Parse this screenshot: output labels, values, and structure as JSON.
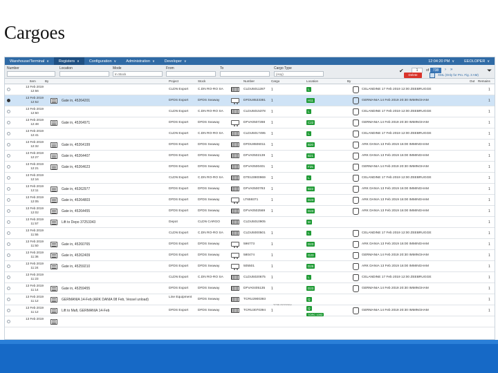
{
  "slide": {
    "title": "Cargoes"
  },
  "menu": {
    "items": [
      {
        "label": "Warehouse/Terminal",
        "active": false
      },
      {
        "label": "Registers",
        "active": true
      },
      {
        "label": "Configuration",
        "active": false
      },
      {
        "label": "Administration",
        "active": false
      },
      {
        "label": "Developer",
        "active": false
      }
    ],
    "time": "12:04:20 PM",
    "user": "EEOLOPER"
  },
  "filters": {
    "number_label": "Number",
    "location_label": "Location",
    "mode_label": "Mode",
    "mode_value": "In Stock",
    "from_label": "From",
    "to_label": "To",
    "cargo_type_label": "Cargo Type",
    "cargo_type_value": "(Any)",
    "page_value": "1",
    "page_of": "of",
    "page_total": "738",
    "delete_label": "Delete",
    "xml_label": "XML (Only for Pro. Fig. 3 AM)"
  },
  "columns": [
    "Item",
    "By",
    "Project",
    "Stock",
    "Number",
    "Cargo",
    "Location",
    "By",
    "Out",
    "Remains"
  ],
  "rows": [
    {
      "date": "13 Feb 2019",
      "time": "12:56",
      "doc": false,
      "subject": "",
      "project": "CLDN Export",
      "stock": "C.DN RO-RO SA",
      "eq": "container",
      "number": "CLDU5011287",
      "cargo": "1",
      "loc": "L",
      "ship": "CELANDINE 17 Feb 2019 12:00 ZEEBRUGGE",
      "remains": "1",
      "selected": false
    },
    {
      "date": "13 Feb 2019",
      "time": "12:52",
      "doc": true,
      "subject": "Gate in, 45264201",
      "project": "DFDS Export",
      "stock": "DFDS Seaway",
      "eq": "truck",
      "number": "DFDU8533381",
      "cargo": "1",
      "loc": "H11",
      "ship": "GERMANIA 14 Feb 2019 20:30 IMMINGHAM",
      "remains": "1",
      "selected": true
    },
    {
      "date": "13 Feb 2019",
      "time": "12:50",
      "doc": false,
      "subject": "",
      "project": "CLDN Export",
      "stock": "C.DN RO-RO SA",
      "eq": "container",
      "number": "CLDU5015378",
      "cargo": "1",
      "loc": "L",
      "ship": "CELANDINE 17 Feb 2019 12:00 ZEEBRUGGE",
      "remains": "1",
      "selected": false
    },
    {
      "date": "13 Feb 2019",
      "time": "12:48",
      "doc": true,
      "subject": "Gate in, 45264971",
      "project": "DFDS Export",
      "stock": "DFDS Seaway",
      "eq": "truck",
      "number": "DFVA0507288",
      "cargo": "1",
      "loc": "C22",
      "ship": "GERMANIA 14 Feb 2019 20:30 IMMINGHAM",
      "remains": "1",
      "selected": false
    },
    {
      "date": "13 Feb 2019",
      "time": "12:41",
      "doc": false,
      "subject": "",
      "project": "CLDN Export",
      "stock": "C.DN RO-RO SA",
      "eq": "container",
      "number": "CLDU5017495",
      "cargo": "1",
      "loc": "L",
      "ship": "CELANDINE 17 Feb 2019 12:00 ZEEBRUGGE",
      "remains": "1",
      "selected": false
    },
    {
      "date": "13 Feb 2019",
      "time": "12:32",
      "doc": true,
      "subject": "Gate in, 45264199",
      "project": "DFDS Export",
      "stock": "DFDS Seaway",
      "eq": "container",
      "number": "DFDU8506011",
      "cargo": "1",
      "loc": "B20",
      "ship": "ARK DANIA 13 Feb 2019 16:00 IMMINGHAM",
      "remains": "1",
      "selected": false
    },
    {
      "date": "13 Feb 2019",
      "time": "12:27",
      "doc": true,
      "subject": "Gate in, 45264407",
      "project": "DFDS Export",
      "stock": "DFDS Seaway",
      "eq": "container",
      "number": "DFVA0502139",
      "cargo": "1",
      "loc": "B21",
      "ship": "ARK DANIA 13 Feb 2019 16:00 IMMINGHAM",
      "remains": "1",
      "selected": false
    },
    {
      "date": "13 Feb 2019",
      "time": "12:21",
      "doc": true,
      "subject": "Gate in, 45264623",
      "project": "DFDS Export",
      "stock": "DFDS Seaway",
      "eq": "container",
      "number": "DFVA0500401",
      "cargo": "1",
      "loc": "F25",
      "ship": "GERMANIA 14 Feb 2019 20:30 IMMINGHAM",
      "remains": "1",
      "selected": false
    },
    {
      "date": "13 Feb 2019",
      "time": "12:16",
      "doc": false,
      "subject": "",
      "project": "CLDN Export",
      "stock": "C.DN RO-RO SA",
      "eq": "container",
      "number": "DTEU3900969",
      "cargo": "1",
      "loc": "L",
      "ship": "CELANDINE 17 Feb 2019 12:00 ZEEBRUGGE",
      "remains": "1",
      "selected": false
    },
    {
      "date": "13 Feb 2019",
      "time": "12:11",
      "doc": true,
      "subject": "Gate in, 45262977",
      "project": "DFDS Export",
      "stock": "DFDS Seaway",
      "eq": "container",
      "number": "DFVA0500783",
      "cargo": "1",
      "loc": "B22",
      "ship": "ARK DANIA 13 Feb 2019 16:00 IMMINGHAM",
      "remains": "1",
      "selected": false
    },
    {
      "date": "13 Feb 2019",
      "time": "12:05",
      "doc": true,
      "subject": "Gate in, 45264803",
      "project": "DFDS Export",
      "stock": "DFDS Seaway",
      "eq": "truck",
      "number": "LT659371",
      "cargo": "1",
      "loc": "D23",
      "ship": "ARK DANIA 13 Feb 2019 16:00 IMMINGHAM",
      "remains": "1",
      "selected": false
    },
    {
      "date": "13 Feb 2019",
      "time": "12:02",
      "doc": true,
      "subject": "Gate in, 45264455",
      "project": "DFDS Export",
      "stock": "DFDS Seaway",
      "eq": "container",
      "number": "DFVA0502569",
      "cargo": "1",
      "loc": "D23",
      "ship": "ARK DANIA 13 Feb 2019 16:00 IMMINGHAM",
      "remains": "1",
      "selected": false
    },
    {
      "date": "13 Feb 2019",
      "time": "11:57",
      "doc": true,
      "subject": "Lift to Depo 37253343",
      "project": "Depot",
      "stock": "CLDN CARGO",
      "eq": "container",
      "number": "CLDU5010905",
      "cargo": "",
      "loc": "M",
      "ship": "",
      "remains": "1",
      "selected": false
    },
    {
      "date": "13 Feb 2019",
      "time": "11:55",
      "doc": false,
      "subject": "",
      "project": "CLDN Export",
      "stock": "C.DN RO-RO SA",
      "eq": "container",
      "number": "CLDU5000501",
      "cargo": "1",
      "loc": "L",
      "ship": "CELANDINE 17 Feb 2019 12:00 ZEEBRUGGE",
      "remains": "1",
      "selected": false
    },
    {
      "date": "13 Feb 2019",
      "time": "11:50",
      "doc": true,
      "subject": "Gate in, 45260765",
      "project": "DFDS Export",
      "stock": "DFDS Seaway",
      "eq": "truck",
      "number": "596773",
      "cargo": "1",
      "loc": "D23",
      "ship": "ARK DANIA 13 Feb 2019 16:00 IMMINGHAM",
      "remains": "1",
      "selected": false
    },
    {
      "date": "13 Feb 2019",
      "time": "11:36",
      "doc": true,
      "subject": "Gate in, 45262409",
      "project": "DFDS Export",
      "stock": "DFDS Seaway",
      "eq": "truck",
      "number": "580474",
      "cargo": "1",
      "loc": "G23",
      "ship": "GERMANIA 14 Feb 2019 20:30 IMMINGHAM",
      "remains": "1",
      "selected": false
    },
    {
      "date": "13 Feb 2019",
      "time": "11:24",
      "doc": true,
      "subject": "Gate in, 45259210",
      "project": "DFDS Export",
      "stock": "DFDS Seaway",
      "eq": "truck",
      "number": "505501",
      "cargo": "1",
      "loc": "D25",
      "ship": "ARK DANIA 13 Feb 2019 16:00 IMMINGHAM",
      "remains": "1",
      "selected": false
    },
    {
      "date": "13 Feb 2019",
      "time": "11:23",
      "doc": false,
      "subject": "",
      "project": "CLDN Export",
      "stock": "C.DN RO-RO SA",
      "eq": "container",
      "number": "CLDU5020675",
      "cargo": "1",
      "loc": "L",
      "ship": "CELANDINE 17 Feb 2019 12:00 ZEEBRUGGE",
      "remains": "1",
      "selected": false
    },
    {
      "date": "13 Feb 2019",
      "time": "11:14",
      "doc": true,
      "subject": "Gate in, 45259455",
      "project": "DFDS Export",
      "stock": "DFDS Seaway",
      "eq": "container",
      "number": "DFVA0405135",
      "cargo": "1",
      "loc": "D23",
      "ship": "GERMANIA 14 Feb 2019 20:30 IMMINGHAM",
      "remains": "1",
      "selected": false
    },
    {
      "date": "13 Feb 2019",
      "time": "11:12",
      "doc": true,
      "subject": "GERMANIA 14-Feb (ARK DANIA 08 Feb, Vessel unload)",
      "project": "Line Equipment",
      "stock": "DFDS Seaway",
      "eq": "container",
      "number": "TCRU2900393",
      "number2": "TCRU3070394",
      "cargo": "",
      "loc": "Q",
      "loc2": "",
      "ship": "",
      "remains": "1",
      "selected": false
    },
    {
      "date": "13 Feb 2019",
      "time": "11:12",
      "doc": true,
      "subject": "Lift to Mafi, GERMANIA 14-Feb",
      "project": "DFDS Export",
      "stock": "DFDS Seaway",
      "eq": "container",
      "number": "TCRU3070394",
      "cargo": "1",
      "loc": "Q",
      "loc2": "TORC 1093",
      "ship": "GERMANIA 14 Feb 2019 20:30 IMMINGHAM",
      "remains": "1",
      "selected": false
    },
    {
      "date": "13 Feb 2019",
      "time": "",
      "doc": true,
      "subject": "",
      "project": "",
      "stock": "",
      "eq": "",
      "number": "",
      "cargo": "",
      "loc": "",
      "ship": "",
      "remains": "",
      "selected": false
    }
  ],
  "colors": {
    "menubar": "#2f6aa5",
    "selected_row": "#cfe3f6",
    "location_badge": "#1f9a35",
    "delete": "#d9342b",
    "bottom_bar": "#1669c6"
  }
}
